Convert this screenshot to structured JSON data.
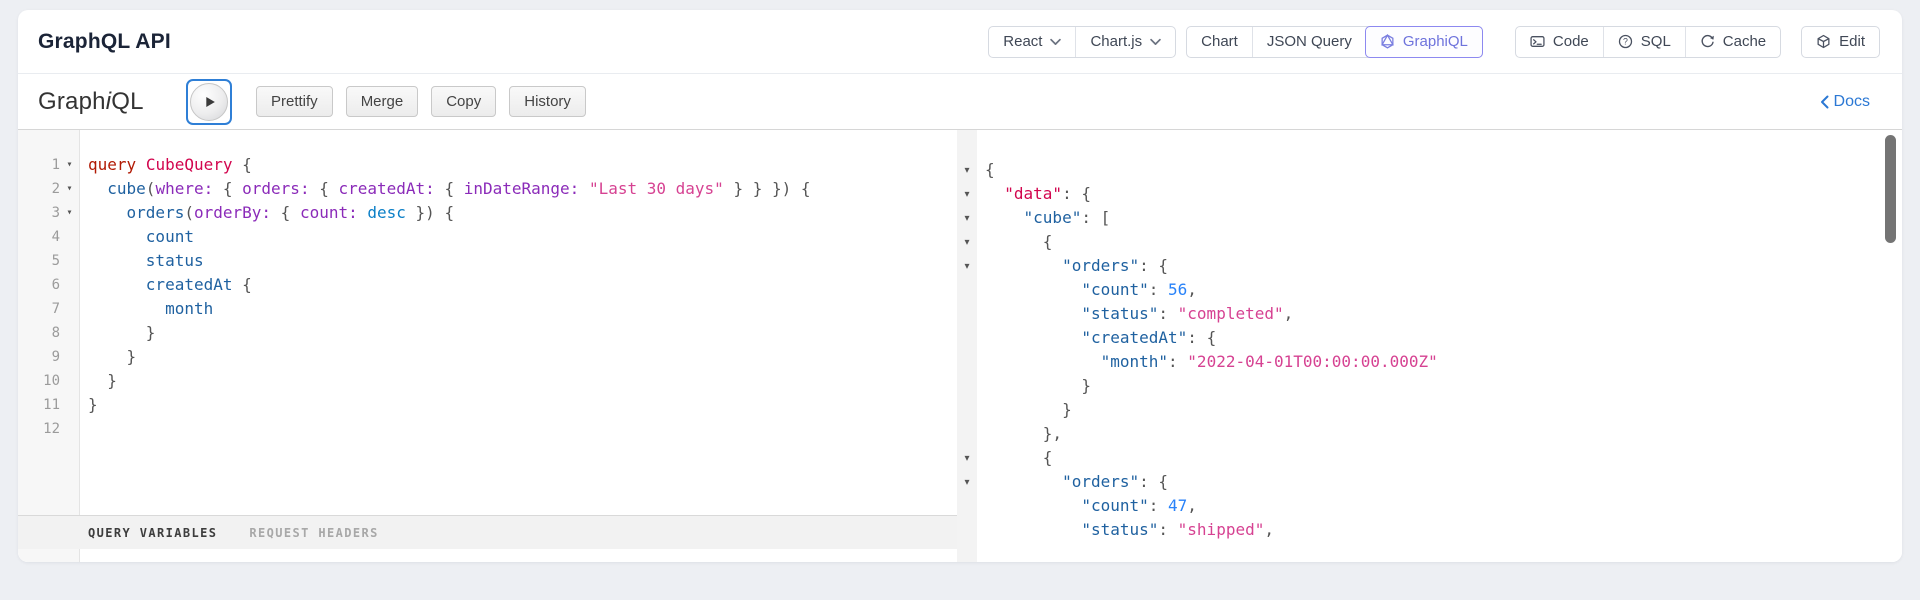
{
  "header": {
    "title": "GraphQL API",
    "framework_select": {
      "label": "React",
      "icon": "chevron-down-icon"
    },
    "library_select": {
      "label": "Chart.js",
      "icon": "chevron-down-icon"
    },
    "view_tabs": [
      {
        "label": "Chart",
        "selected": false
      },
      {
        "label": "JSON Query",
        "selected": false
      },
      {
        "label": "GraphiQL",
        "selected": true,
        "icon": "graphql-logo-icon"
      }
    ],
    "action_buttons": [
      {
        "label": "Code",
        "icon": "terminal-icon"
      },
      {
        "label": "SQL",
        "icon": "help-circle-icon"
      },
      {
        "label": "Cache",
        "icon": "refresh-icon"
      }
    ],
    "edit_button": {
      "label": "Edit",
      "icon": "cube-icon"
    }
  },
  "toolbar": {
    "logo": {
      "pre": "Graph",
      "i": "i",
      "post": "QL"
    },
    "buttons": [
      "Prettify",
      "Merge",
      "Copy",
      "History"
    ],
    "execute_icon": "play-icon",
    "docs_label": "Docs",
    "docs_icon": "chevron-left-icon"
  },
  "query_editor": {
    "fold_rows": [
      1,
      2,
      3
    ],
    "lines": [
      [
        {
          "c": "kw",
          "t": "query"
        },
        {
          "c": "p",
          "t": " "
        },
        {
          "c": "def",
          "t": "CubeQuery"
        },
        {
          "c": "p",
          "t": " {"
        }
      ],
      [
        {
          "c": "p",
          "t": "  "
        },
        {
          "c": "prop",
          "t": "cube"
        },
        {
          "c": "p",
          "t": "("
        },
        {
          "c": "attr",
          "t": "where:"
        },
        {
          "c": "p",
          "t": " { "
        },
        {
          "c": "attr",
          "t": "orders:"
        },
        {
          "c": "p",
          "t": " { "
        },
        {
          "c": "attr",
          "t": "createdAt:"
        },
        {
          "c": "p",
          "t": " { "
        },
        {
          "c": "attr",
          "t": "inDateRange:"
        },
        {
          "c": "p",
          "t": " "
        },
        {
          "c": "str",
          "t": "\"Last 30 days\""
        },
        {
          "c": "p",
          "t": " } } }) {"
        }
      ],
      [
        {
          "c": "p",
          "t": "    "
        },
        {
          "c": "prop",
          "t": "orders"
        },
        {
          "c": "p",
          "t": "("
        },
        {
          "c": "attr",
          "t": "orderBy:"
        },
        {
          "c": "p",
          "t": " { "
        },
        {
          "c": "attr",
          "t": "count:"
        },
        {
          "c": "p",
          "t": " "
        },
        {
          "c": "str2",
          "t": "desc"
        },
        {
          "c": "p",
          "t": " }) {"
        }
      ],
      [
        {
          "c": "p",
          "t": "      "
        },
        {
          "c": "prop",
          "t": "count"
        }
      ],
      [
        {
          "c": "p",
          "t": "      "
        },
        {
          "c": "prop",
          "t": "status"
        }
      ],
      [
        {
          "c": "p",
          "t": "      "
        },
        {
          "c": "prop",
          "t": "createdAt"
        },
        {
          "c": "p",
          "t": " {"
        }
      ],
      [
        {
          "c": "p",
          "t": "        "
        },
        {
          "c": "prop",
          "t": "month"
        }
      ],
      [
        {
          "c": "p",
          "t": "      }"
        }
      ],
      [
        {
          "c": "p",
          "t": "    }"
        }
      ],
      [
        {
          "c": "p",
          "t": "  }"
        }
      ],
      [
        {
          "c": "p",
          "t": "}"
        }
      ],
      []
    ]
  },
  "variables_bar": {
    "tabs": [
      {
        "label": "QUERY VARIABLES",
        "active": true
      },
      {
        "label": "REQUEST HEADERS",
        "active": false
      }
    ]
  },
  "response_viewer": {
    "fold_rows": [
      1,
      2,
      3,
      4,
      5,
      13,
      14
    ],
    "lines": [
      [
        {
          "c": "p",
          "t": "{"
        }
      ],
      [
        {
          "c": "p",
          "t": "  "
        },
        {
          "c": "kdef",
          "t": "\"data\""
        },
        {
          "c": "p",
          "t": ": {"
        }
      ],
      [
        {
          "c": "p",
          "t": "    "
        },
        {
          "c": "key",
          "t": "\"cube\""
        },
        {
          "c": "p",
          "t": ": ["
        }
      ],
      [
        {
          "c": "p",
          "t": "      {"
        }
      ],
      [
        {
          "c": "p",
          "t": "        "
        },
        {
          "c": "key",
          "t": "\"orders\""
        },
        {
          "c": "p",
          "t": ": {"
        }
      ],
      [
        {
          "c": "p",
          "t": "          "
        },
        {
          "c": "key",
          "t": "\"count\""
        },
        {
          "c": "p",
          "t": ": "
        },
        {
          "c": "num",
          "t": "56"
        },
        {
          "c": "p",
          "t": ","
        }
      ],
      [
        {
          "c": "p",
          "t": "          "
        },
        {
          "c": "key",
          "t": "\"status\""
        },
        {
          "c": "p",
          "t": ": "
        },
        {
          "c": "str",
          "t": "\"completed\""
        },
        {
          "c": "p",
          "t": ","
        }
      ],
      [
        {
          "c": "p",
          "t": "          "
        },
        {
          "c": "key",
          "t": "\"createdAt\""
        },
        {
          "c": "p",
          "t": ": {"
        }
      ],
      [
        {
          "c": "p",
          "t": "            "
        },
        {
          "c": "key",
          "t": "\"month\""
        },
        {
          "c": "p",
          "t": ": "
        },
        {
          "c": "str",
          "t": "\"2022-04-01T00:00:00.000Z\""
        }
      ],
      [
        {
          "c": "p",
          "t": "          }"
        }
      ],
      [
        {
          "c": "p",
          "t": "        }"
        }
      ],
      [
        {
          "c": "p",
          "t": "      },"
        }
      ],
      [
        {
          "c": "p",
          "t": "      {"
        }
      ],
      [
        {
          "c": "p",
          "t": "        "
        },
        {
          "c": "key",
          "t": "\"orders\""
        },
        {
          "c": "p",
          "t": ": {"
        }
      ],
      [
        {
          "c": "p",
          "t": "          "
        },
        {
          "c": "key",
          "t": "\"count\""
        },
        {
          "c": "p",
          "t": ": "
        },
        {
          "c": "num",
          "t": "47"
        },
        {
          "c": "p",
          "t": ","
        }
      ],
      [
        {
          "c": "p",
          "t": "          "
        },
        {
          "c": "key",
          "t": "\"status\""
        },
        {
          "c": "p",
          "t": ": "
        },
        {
          "c": "str",
          "t": "\"shipped\""
        },
        {
          "c": "p",
          "t": ","
        }
      ]
    ]
  },
  "colors": {
    "page_background": "#edeff3",
    "selected_tab_accent": "#6e73dc",
    "selected_tab_border": "#8d89f0",
    "docs_link": "#2b78d4",
    "execute_focus_ring": "#2f7fd6",
    "syntax": {
      "keyword": "#B11A04",
      "definition": "#D2054E",
      "property": "#1F61A0",
      "attribute": "#8B2BB9",
      "string": "#D64292",
      "enum_value": "#0B7FC7",
      "number": "#2882F9",
      "punctuation": "#555555"
    }
  }
}
